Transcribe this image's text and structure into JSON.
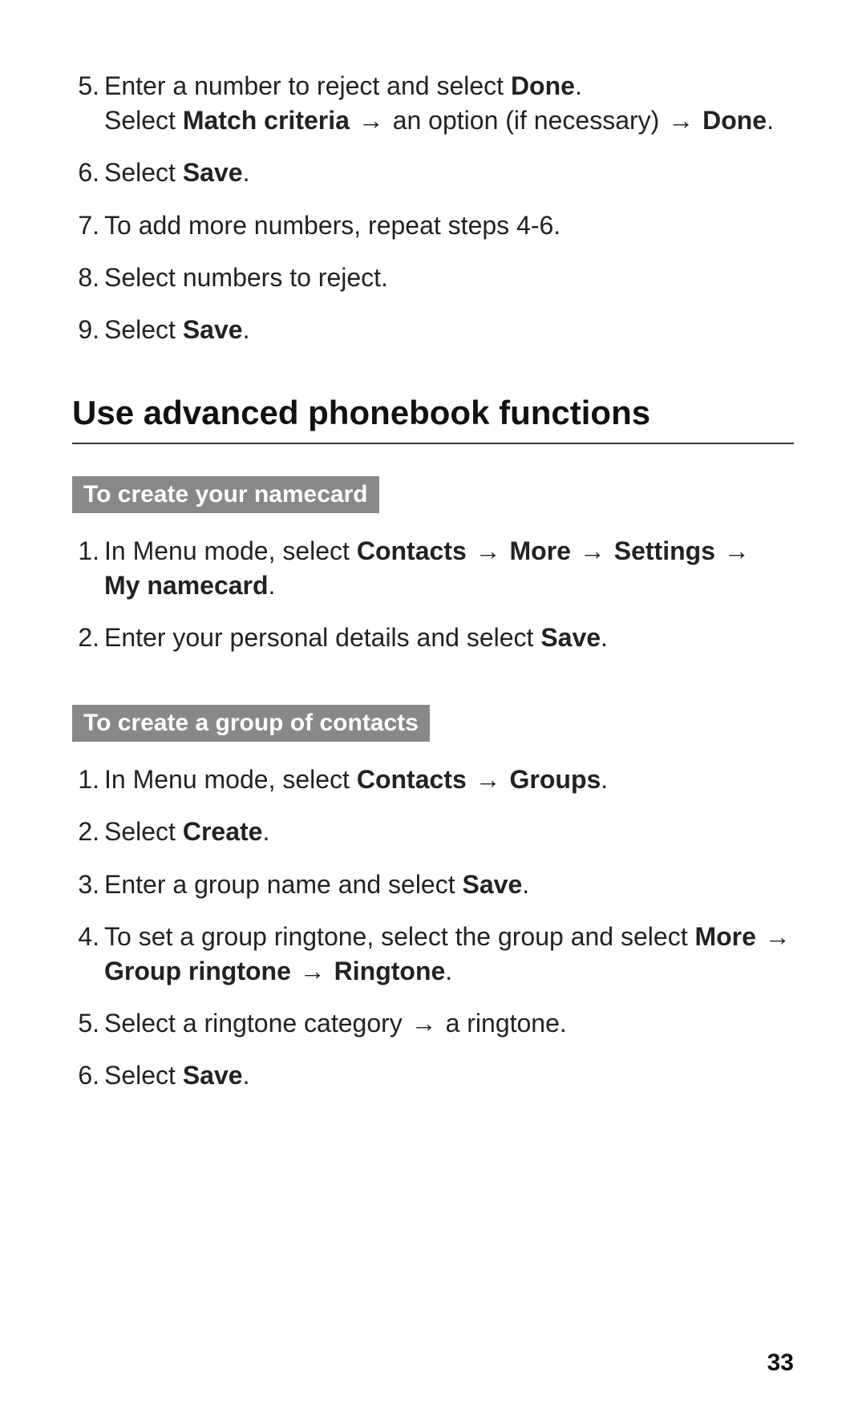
{
  "arrow": "→",
  "listA": {
    "5_num": "5.",
    "5a": "Enter a number to reject and select ",
    "5b_bold": "Done",
    "5c": ".",
    "5sub_a": "Select ",
    "5sub_b_bold": "Match criteria",
    "5sub_c": " ",
    "5sub_d": " an option (if necessary) ",
    "5sub_e": " ",
    "5sub_f_bold": "Done",
    "5sub_g": ".",
    "6_num": "6.",
    "6a": "Select ",
    "6b_bold": "Save",
    "6c": ".",
    "7_num": "7.",
    "7": "To add more numbers, repeat steps 4-6.",
    "8_num": "8.",
    "8": "Select numbers to reject.",
    "9_num": "9.",
    "9a": "Select ",
    "9b_bold": "Save",
    "9c": "."
  },
  "section_heading": "Use advanced phonebook functions",
  "sub1": "To create your namecard",
  "listB": {
    "1_num": "1.",
    "1a": "In Menu mode, select ",
    "1b_bold": "Contacts",
    "1c": " ",
    "1d_bold": "More",
    "1e": " ",
    "1f_bold": "Settings",
    "1g": " ",
    "1h_bold": "My namecard",
    "1i": ".",
    "2_num": "2.",
    "2a": "Enter your personal details and select ",
    "2b_bold": "Save",
    "2c": "."
  },
  "sub2": "To create a group of contacts",
  "listC": {
    "1_num": "1.",
    "1a": "In Menu mode, select ",
    "1b_bold": "Contacts",
    "1c": " ",
    "1d_bold": "Groups",
    "1e": ".",
    "2_num": "2.",
    "2a": "Select ",
    "2b_bold": "Create",
    "2c": ".",
    "3_num": "3.",
    "3a": "Enter a group name and select ",
    "3b_bold": "Save",
    "3c": ".",
    "4_num": "4.",
    "4a": "To set a group ringtone, select the group and select ",
    "4b_bold": "More",
    "4c": " ",
    "4d_bold": "Group ringtone",
    "4e": " ",
    "4f_bold": "Ringtone",
    "4g": ".",
    "5_num": "5.",
    "5a": "Select a ringtone category ",
    "5b": " a ringtone.",
    "6_num": "6.",
    "6a": "Select ",
    "6b_bold": "Save",
    "6c": "."
  },
  "page_number": "33"
}
